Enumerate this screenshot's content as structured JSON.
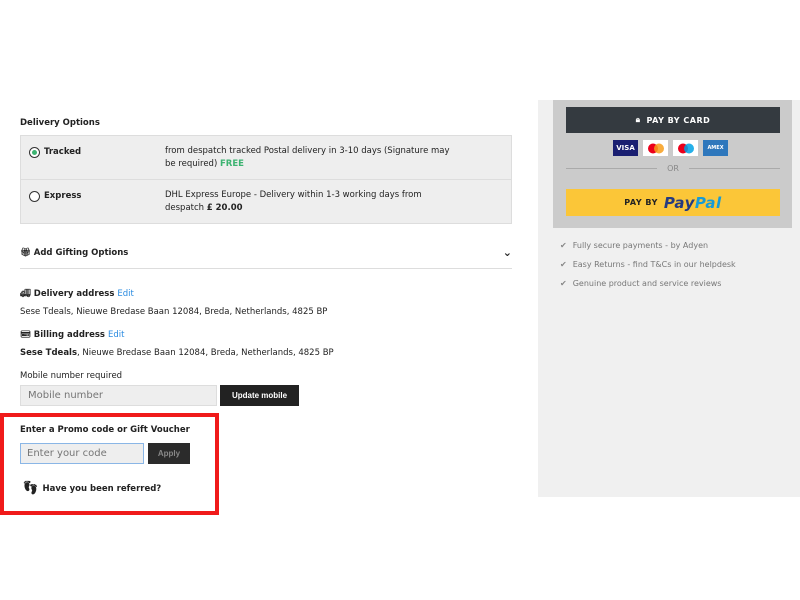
{
  "delivery": {
    "title": "Delivery Options",
    "options": [
      {
        "label": "Tracked",
        "desc": "from despatch tracked Postal delivery in 3-10 days (Signature may be required)",
        "price": "FREE",
        "selected": true
      },
      {
        "label": "Express",
        "desc": "DHL Express Europe - Delivery within 1-3 working days from despatch",
        "price": "£ 20.00",
        "selected": false
      }
    ]
  },
  "gifting": {
    "label": "Add Gifting Options",
    "icon": "gift-icon"
  },
  "delivery_address": {
    "label": "Delivery address",
    "edit": "Edit",
    "value": "Sese Tdeals, Nieuwe Bredase Baan 12084, Breda, Netherlands, 4825 BP"
  },
  "billing_address": {
    "label": "Billing address",
    "edit": "Edit",
    "name": "Sese Tdeals",
    "rest": ", Nieuwe Bredase Baan 12084, Breda, Netherlands, 4825 BP"
  },
  "mobile": {
    "label": "Mobile number required",
    "placeholder": "Mobile number",
    "button": "Update mobile"
  },
  "promo": {
    "title": "Enter a Promo code or Gift Voucher",
    "placeholder": "Enter your code",
    "button": "Apply",
    "referred": "Have you been referred?"
  },
  "payment": {
    "card_button": "PAY BY CARD",
    "cards": [
      "VISA",
      "Mastercard",
      "Maestro",
      "AMEX"
    ],
    "or": "OR",
    "paypal_prefix": "PAY BY",
    "paypal_a": "Pay",
    "paypal_b": "Pal",
    "assurances": [
      "Fully secure payments - by Adyen",
      "Easy Returns - find T&Cs in our helpdesk",
      "Genuine product and service reviews"
    ]
  },
  "colors": {
    "highlight": "#f01a1a",
    "paypal": "#fbc638",
    "card_button": "#343a40",
    "free": "#3cb371",
    "link": "#2a8be0"
  }
}
